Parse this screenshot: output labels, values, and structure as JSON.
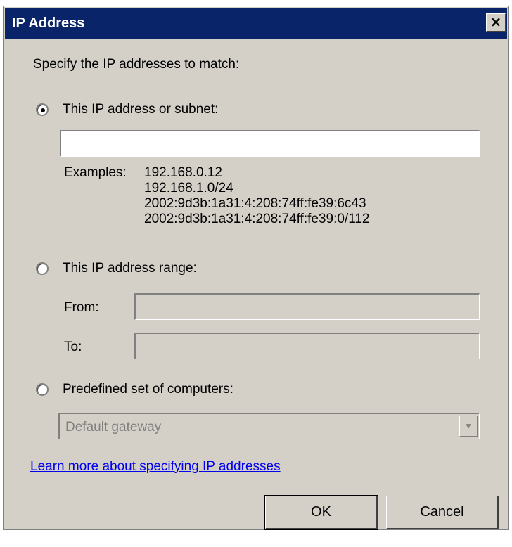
{
  "window": {
    "title": "IP Address",
    "close_symbol": "×"
  },
  "prompt": "Specify the IP addresses to match:",
  "options": {
    "subnet": {
      "label": "This IP address or subnet:",
      "selected": true,
      "value": "",
      "examples_label": "Examples:",
      "examples": [
        "192.168.0.12",
        "192.168.1.0/24",
        "2002:9d3b:1a31:4:208:74ff:fe39:6c43",
        "2002:9d3b:1a31:4:208:74ff:fe39:0/112"
      ]
    },
    "range": {
      "label": "This IP address range:",
      "selected": false,
      "from_label": "From:",
      "to_label": "To:",
      "from_value": "",
      "to_value": ""
    },
    "predefined": {
      "label": "Predefined set of computers:",
      "selected": false,
      "selected_value": "Default gateway"
    }
  },
  "link_text": "Learn more about specifying IP addresses",
  "buttons": {
    "ok": "OK",
    "cancel": "Cancel"
  },
  "colors": {
    "titlebar": "#0a246a",
    "dialog_bg": "#d4d0c8",
    "link": "#0000ee"
  }
}
